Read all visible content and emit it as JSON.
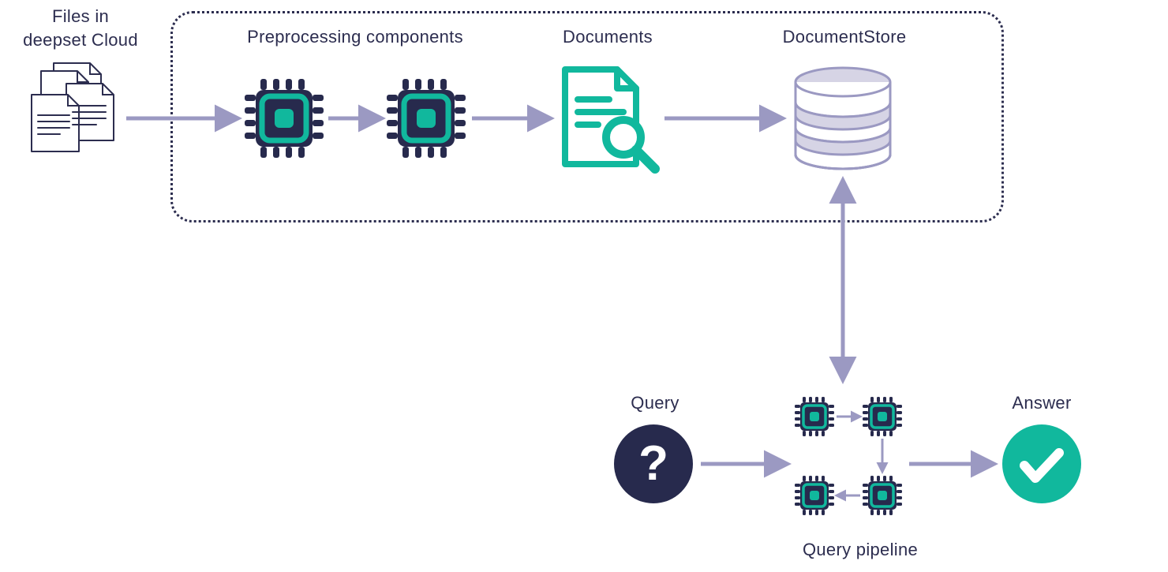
{
  "labels": {
    "files": "Files in\ndeepset Cloud",
    "preprocessing": "Preprocessing components",
    "documents": "Documents",
    "documentstore": "DocumentStore",
    "query": "Query",
    "query_pipeline": "Query pipeline",
    "answer": "Answer"
  },
  "colors": {
    "navy": "#272a4d",
    "teal": "#11b89d",
    "arrow": "#9b99c2",
    "dbFill": "#d6d4e5",
    "dbStroke": "#9b99c2"
  }
}
